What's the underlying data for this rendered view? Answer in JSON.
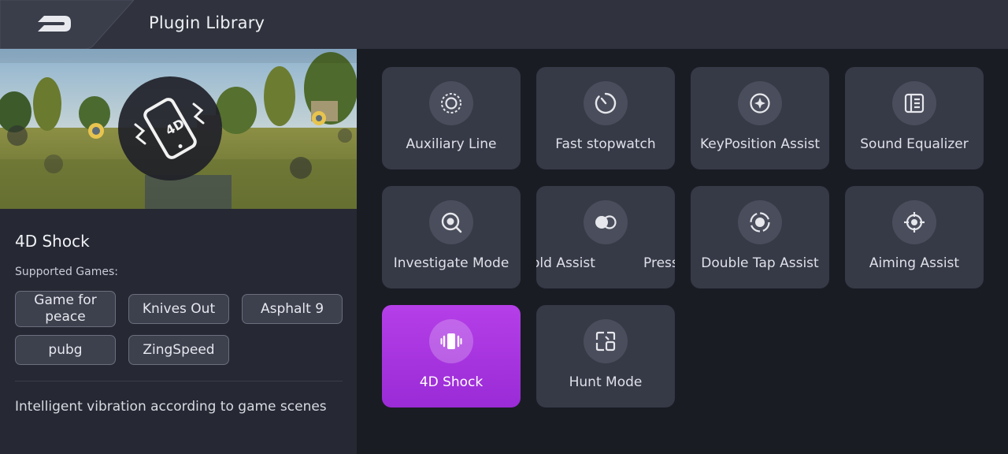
{
  "header": {
    "title": "Plugin Library"
  },
  "detail": {
    "name": "4D Shock",
    "supported_label": "Supported Games:",
    "games": [
      "Game for peace",
      "Knives Out",
      "Asphalt 9",
      "pubg",
      "ZingSpeed"
    ],
    "description": "Intelligent vibration according to game scenes"
  },
  "preview": {
    "badge_icon": "phone-vibrate-4d-icon",
    "badge_text": "4D"
  },
  "plugins": [
    {
      "label": "Auxiliary Line",
      "icon": "ring-target-icon"
    },
    {
      "label": "Fast stopwatch",
      "icon": "stopwatch-icon"
    },
    {
      "label": "KeyPosition Assist",
      "icon": "crosshair-diamond-icon"
    },
    {
      "label": "Sound Equalizer",
      "icon": "equalizer-icon"
    },
    {
      "label": "Investigate Mode",
      "icon": "magnifier-icon"
    },
    {
      "label": "old Assist",
      "label_b": "Press",
      "icon": "toggle-circles-icon"
    },
    {
      "label": "Double Tap Assist",
      "icon": "double-tap-icon"
    },
    {
      "label": "Aiming Assist",
      "icon": "aim-icon"
    },
    {
      "label": "4D Shock",
      "icon": "vibrate-icon",
      "active": true
    },
    {
      "label": "Hunt Mode",
      "icon": "hunt-mode-icon"
    }
  ],
  "colors": {
    "accent": "#a836e0",
    "tile": "#363946",
    "header": "#30323d"
  }
}
